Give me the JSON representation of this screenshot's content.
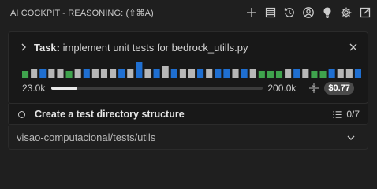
{
  "header": {
    "title": "AI COCKPIT - REASONING: (⇧⌘A)",
    "actions": [
      "plus-icon",
      "history-list-icon",
      "history-icon",
      "account-icon",
      "lightbulb-icon",
      "settings-icon",
      "open-external-icon"
    ]
  },
  "task": {
    "prefix": "Task:",
    "text": "implement unit tests for bedrock_utills.py",
    "bars": [
      {
        "color": "#3fa34d",
        "h": 0.45
      },
      {
        "color": "#b7b7b7",
        "h": 0.55
      },
      {
        "color": "#1f6fd1",
        "h": 0.55
      },
      {
        "color": "#b7b7b7",
        "h": 0.55
      },
      {
        "color": "#b7b7b7",
        "h": 0.55
      },
      {
        "color": "#3fa34d",
        "h": 0.45
      },
      {
        "color": "#b7b7b7",
        "h": 0.55
      },
      {
        "color": "#1f6fd1",
        "h": 0.55
      },
      {
        "color": "#b7b7b7",
        "h": 0.55
      },
      {
        "color": "#b7b7b7",
        "h": 0.55
      },
      {
        "color": "#b7b7b7",
        "h": 0.55
      },
      {
        "color": "#1f6fd1",
        "h": 0.55
      },
      {
        "color": "#b7b7b7",
        "h": 0.55
      },
      {
        "color": "#1f6fd1",
        "h": 1.0
      },
      {
        "color": "#b7b7b7",
        "h": 0.55
      },
      {
        "color": "#1f6fd1",
        "h": 0.55
      },
      {
        "color": "#b7b7b7",
        "h": 0.75
      },
      {
        "color": "#1f6fd1",
        "h": 0.55
      },
      {
        "color": "#b7b7b7",
        "h": 0.55
      },
      {
        "color": "#b7b7b7",
        "h": 0.55
      },
      {
        "color": "#1f6fd1",
        "h": 0.55
      },
      {
        "color": "#b7b7b7",
        "h": 0.55
      },
      {
        "color": "#1f6fd1",
        "h": 0.55
      },
      {
        "color": "#1f6fd1",
        "h": 0.55
      },
      {
        "color": "#b7b7b7",
        "h": 0.55
      },
      {
        "color": "#1f6fd1",
        "h": 0.55
      },
      {
        "color": "#b7b7b7",
        "h": 0.55
      },
      {
        "color": "#3fa34d",
        "h": 0.45
      },
      {
        "color": "#3fa34d",
        "h": 0.45
      },
      {
        "color": "#3fa34d",
        "h": 0.45
      },
      {
        "color": "#b7b7b7",
        "h": 0.55
      },
      {
        "color": "#1f6fd1",
        "h": 0.55
      },
      {
        "color": "#b7b7b7",
        "h": 0.55
      },
      {
        "color": "#3fa34d",
        "h": 0.45
      },
      {
        "color": "#3fa34d",
        "h": 0.45
      },
      {
        "color": "#1f6fd1",
        "h": 0.55
      },
      {
        "color": "#b7b7b7",
        "h": 0.55
      },
      {
        "color": "#b7b7b7",
        "h": 0.55
      },
      {
        "color": "#1f6fd1",
        "h": 0.55
      }
    ],
    "context": {
      "min": "23.0k",
      "max": "200.0k",
      "progress": 0.12
    },
    "cost": "$0.77"
  },
  "step": {
    "label": "Create a test directory structure",
    "count": "0/7"
  },
  "path": {
    "value": "visao-computacional/tests/utils"
  }
}
